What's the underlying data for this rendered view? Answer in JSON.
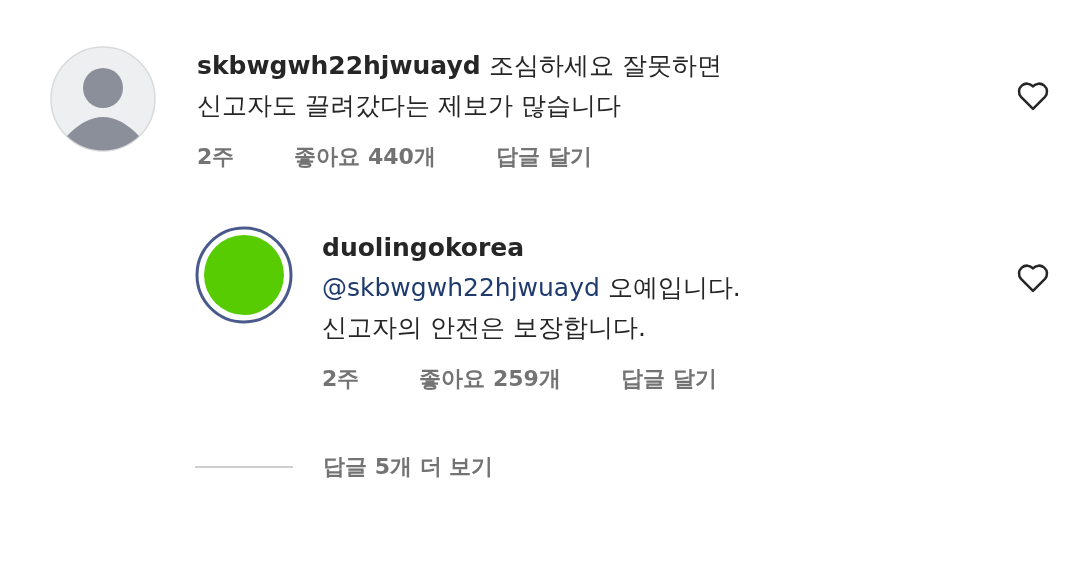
{
  "comments": [
    {
      "avatar": {
        "kind": "silhouette"
      },
      "username": "skbwgwh22hjwuayd",
      "body_lines": [
        "조심하세요 잘못하면",
        "신고자도 끌려갔다는 제보가 많습니다"
      ],
      "time": "2주",
      "likes": "좋아요 440개",
      "reply": "답글 달기",
      "liked": false
    },
    {
      "avatar": {
        "kind": "ringed"
      },
      "username": "duolingokorea",
      "mention": "@skbwgwh22hjwuayd",
      "body_lines": [
        "오예입니다.",
        "신고자의 안전은 보장합니다."
      ],
      "time": "2주",
      "likes": "좋아요 259개",
      "reply": "답글 달기",
      "liked": false
    }
  ],
  "more_replies": "답글 5개 더 보기"
}
